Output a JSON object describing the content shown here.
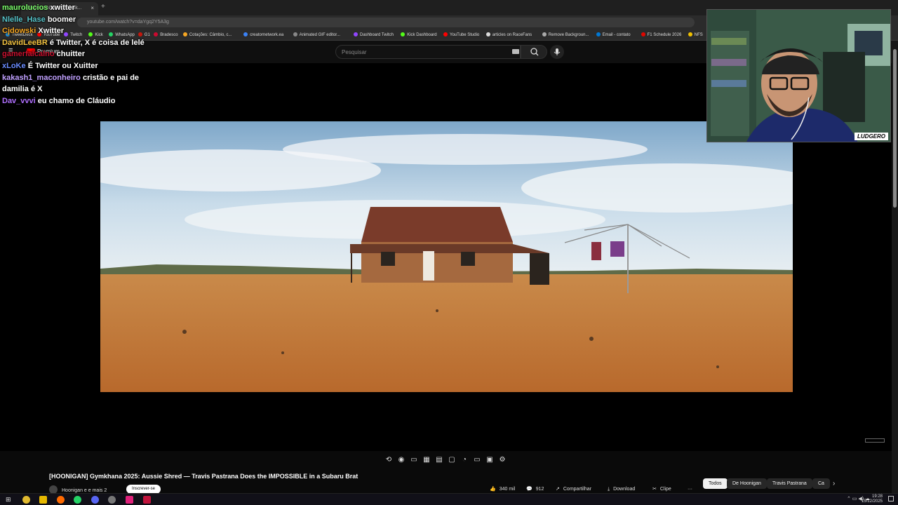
{
  "browser": {
    "tab_title": "(5) [HOONIGAN] Gymk...",
    "url": "youtube.com/watch?v=daYgq2Y5A3g",
    "bookmarks": [
      {
        "label": "TweetDeck",
        "color": "#1d9bf0"
      },
      {
        "label": "YouTube",
        "color": "#ff0000"
      },
      {
        "label": "Twitch",
        "color": "#9146ff"
      },
      {
        "label": "Kick",
        "color": "#53fc18"
      },
      {
        "label": "WhatsApp",
        "color": "#25d366"
      },
      {
        "label": "G1",
        "color": "#c4170c"
      },
      {
        "label": "Bradesco",
        "color": "#cc092f"
      },
      {
        "label": "Cotações: Câmbio, c...",
        "color": "#f5a623"
      },
      {
        "label": "creatornetwork.ea",
        "color": "#3b82f6"
      },
      {
        "label": "Animated GIF editor...",
        "color": "#888888"
      },
      {
        "label": "Dashboard Twitch",
        "color": "#9146ff"
      },
      {
        "label": "Kick Dashboard",
        "color": "#53fc18"
      },
      {
        "label": "YouTube Studio",
        "color": "#ff0000"
      },
      {
        "label": "articles on RaceFans",
        "color": "#dddddd"
      },
      {
        "label": "Remove Backgroun...",
        "color": "#aaaaaa"
      },
      {
        "label": "Email - contato",
        "color": "#0078d4"
      },
      {
        "label": "F1 Schedule 2026",
        "color": "#e10600"
      },
      {
        "label": "NFS",
        "color": "#f0c000"
      }
    ]
  },
  "youtube": {
    "logo_text": "Premium",
    "search_placeholder": "Pesquisar",
    "video_title": "[HOONIGAN] Gymkhana 2025: Aussie Shred — Travis Pastrana Does the IMPOSSIBLE in a Subaru Brat",
    "channel": "Hoonigan e e mais 2",
    "subscribe_label": "Inscrever-se",
    "actions": [
      {
        "icon": "👍",
        "label": "340 mil",
        "name": "like-button"
      },
      {
        "icon": "💬",
        "label": "912",
        "name": "comments-button"
      },
      {
        "icon": "↗",
        "label": "Compartilhar",
        "name": "share-button"
      },
      {
        "icon": "⤓",
        "label": "Download",
        "name": "download-button"
      },
      {
        "icon": "✂",
        "label": "Clipe",
        "name": "clip-button"
      },
      {
        "icon": "",
        "label": "···",
        "name": "more-button"
      }
    ],
    "chips": [
      "Todos",
      "De Hoonigan",
      "Travis Pastrana",
      "Ca"
    ]
  },
  "chat": [
    {
      "user": "maurolucios",
      "color": "#7cff6b",
      "text": "xwitter"
    },
    {
      "user": "Nlelle_Hase",
      "color": "#57c3c9",
      "text": "boomer"
    },
    {
      "user": "Cjdowski",
      "color": "#f5a623",
      "text": "Xwitter"
    },
    {
      "user": "DavidLeeBR",
      "color": "#f5c542",
      "text": "é Twitter, X é coisa de lelé"
    },
    {
      "user": "gamerfalcalno",
      "color": "#c8102e",
      "text": "chuitter"
    },
    {
      "user": "xLoKe",
      "color": "#6a8cff",
      "text": "É Twitter ou Xuitter"
    },
    {
      "user": "kakash1_maconheiro",
      "color": "#c0a0ff",
      "text": "cristão e pai de damilia é X"
    },
    {
      "user": "Dav_vvvi",
      "color": "#b070ff",
      "text": "eu chamo de Cláudio"
    }
  ],
  "webcam": {
    "tag": "LUDGERO"
  },
  "taskbar": {
    "time": "19:28",
    "date": "15/12/2025"
  }
}
